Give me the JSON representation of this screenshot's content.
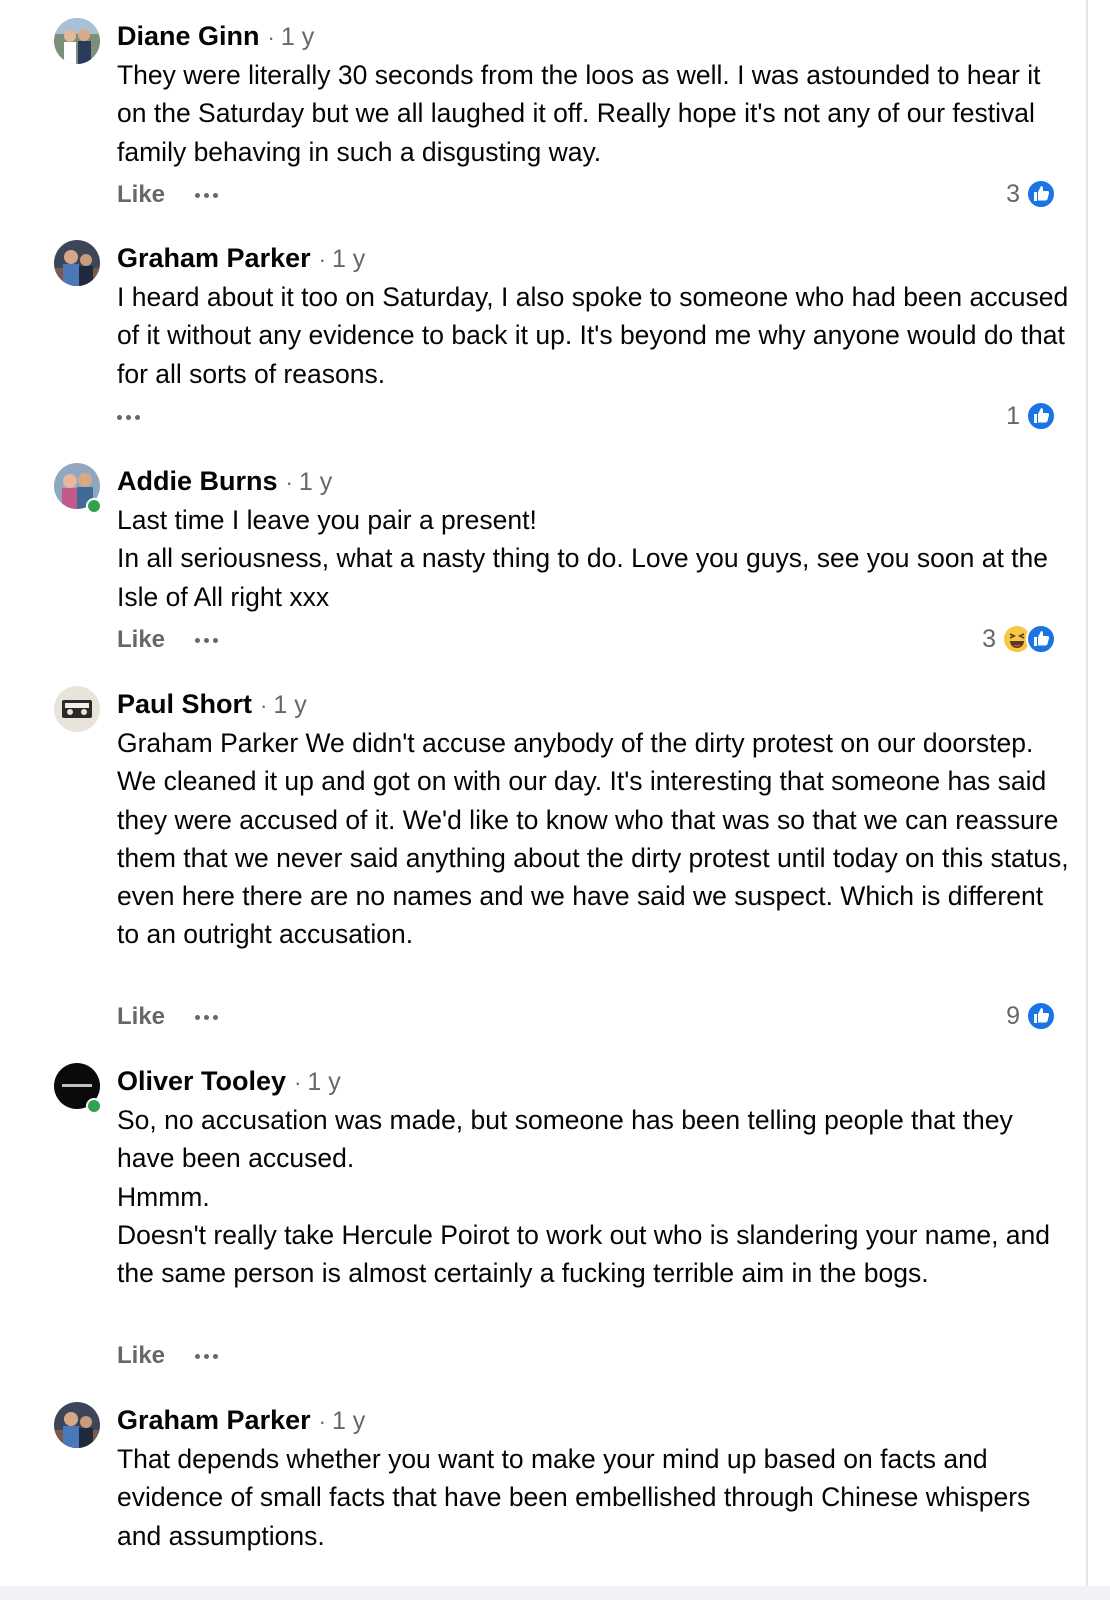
{
  "comments": [
    {
      "author": "Diane Ginn",
      "time": "1 y",
      "text": "They were literally 30 seconds from the loos as well.  I was astounded to hear it on the Saturday but we all laughed it off.  Really hope it's not any of our festival family behaving in such a disgusting way.",
      "like_label": "Like",
      "reaction_count": "3",
      "reactions": [
        "like-icon"
      ]
    },
    {
      "author": "Graham Parker",
      "time": "1 y",
      "text": "I heard about it too on Saturday, I also spoke to someone who had been accused of it without any evidence to back it up. It's beyond me why anyone would do that for all sorts of reasons.",
      "like_label": "",
      "reaction_count": "1",
      "reactions": [
        "like-icon"
      ]
    },
    {
      "author": "Addie Burns",
      "time": "1 y",
      "text": "Last time I leave you pair a present!\nIn all seriousness, what a nasty thing to do. Love you guys, see you soon at the Isle of All right xxx",
      "like_label": "Like",
      "reaction_count": "3",
      "reactions": [
        "haha-icon",
        "like-icon"
      ]
    },
    {
      "author": "Paul Short",
      "time": "1 y",
      "text": "Graham Parker We didn't accuse anybody of the dirty protest on our doorstep. We cleaned it up and got on with our day. It's interesting that someone has said they were accused of it. We'd like to know who that was so that we can reassure them that we never said anything about the dirty protest until today on this status, even here there are no names and we have said we suspect. Which is different to an outright accusation.",
      "like_label": "Like",
      "reaction_count": "9",
      "reactions": [
        "like-icon"
      ]
    },
    {
      "author": "Oliver Tooley",
      "time": "1 y",
      "text": "So, no accusation was made, but someone has been telling people that they have been accused.\nHmmm.\nDoesn't really take Hercule Poirot to work out who is slandering your name, and the same person is almost certainly a fucking terrible aim in the bogs.",
      "like_label": "Like",
      "reaction_count": "",
      "reactions": []
    },
    {
      "author": "Graham Parker",
      "time": "1 y",
      "text": "That depends whether you want to make your mind up based on facts and evidence of small facts that have been embellished through Chinese whispers and assumptions.",
      "like_label": "",
      "reaction_count": "",
      "reactions": []
    }
  ],
  "separator": "·",
  "colors": {
    "like_blue": "#1b74e4",
    "online_green": "#31a24c",
    "meta_gray": "#65676b",
    "text": "#050505"
  }
}
